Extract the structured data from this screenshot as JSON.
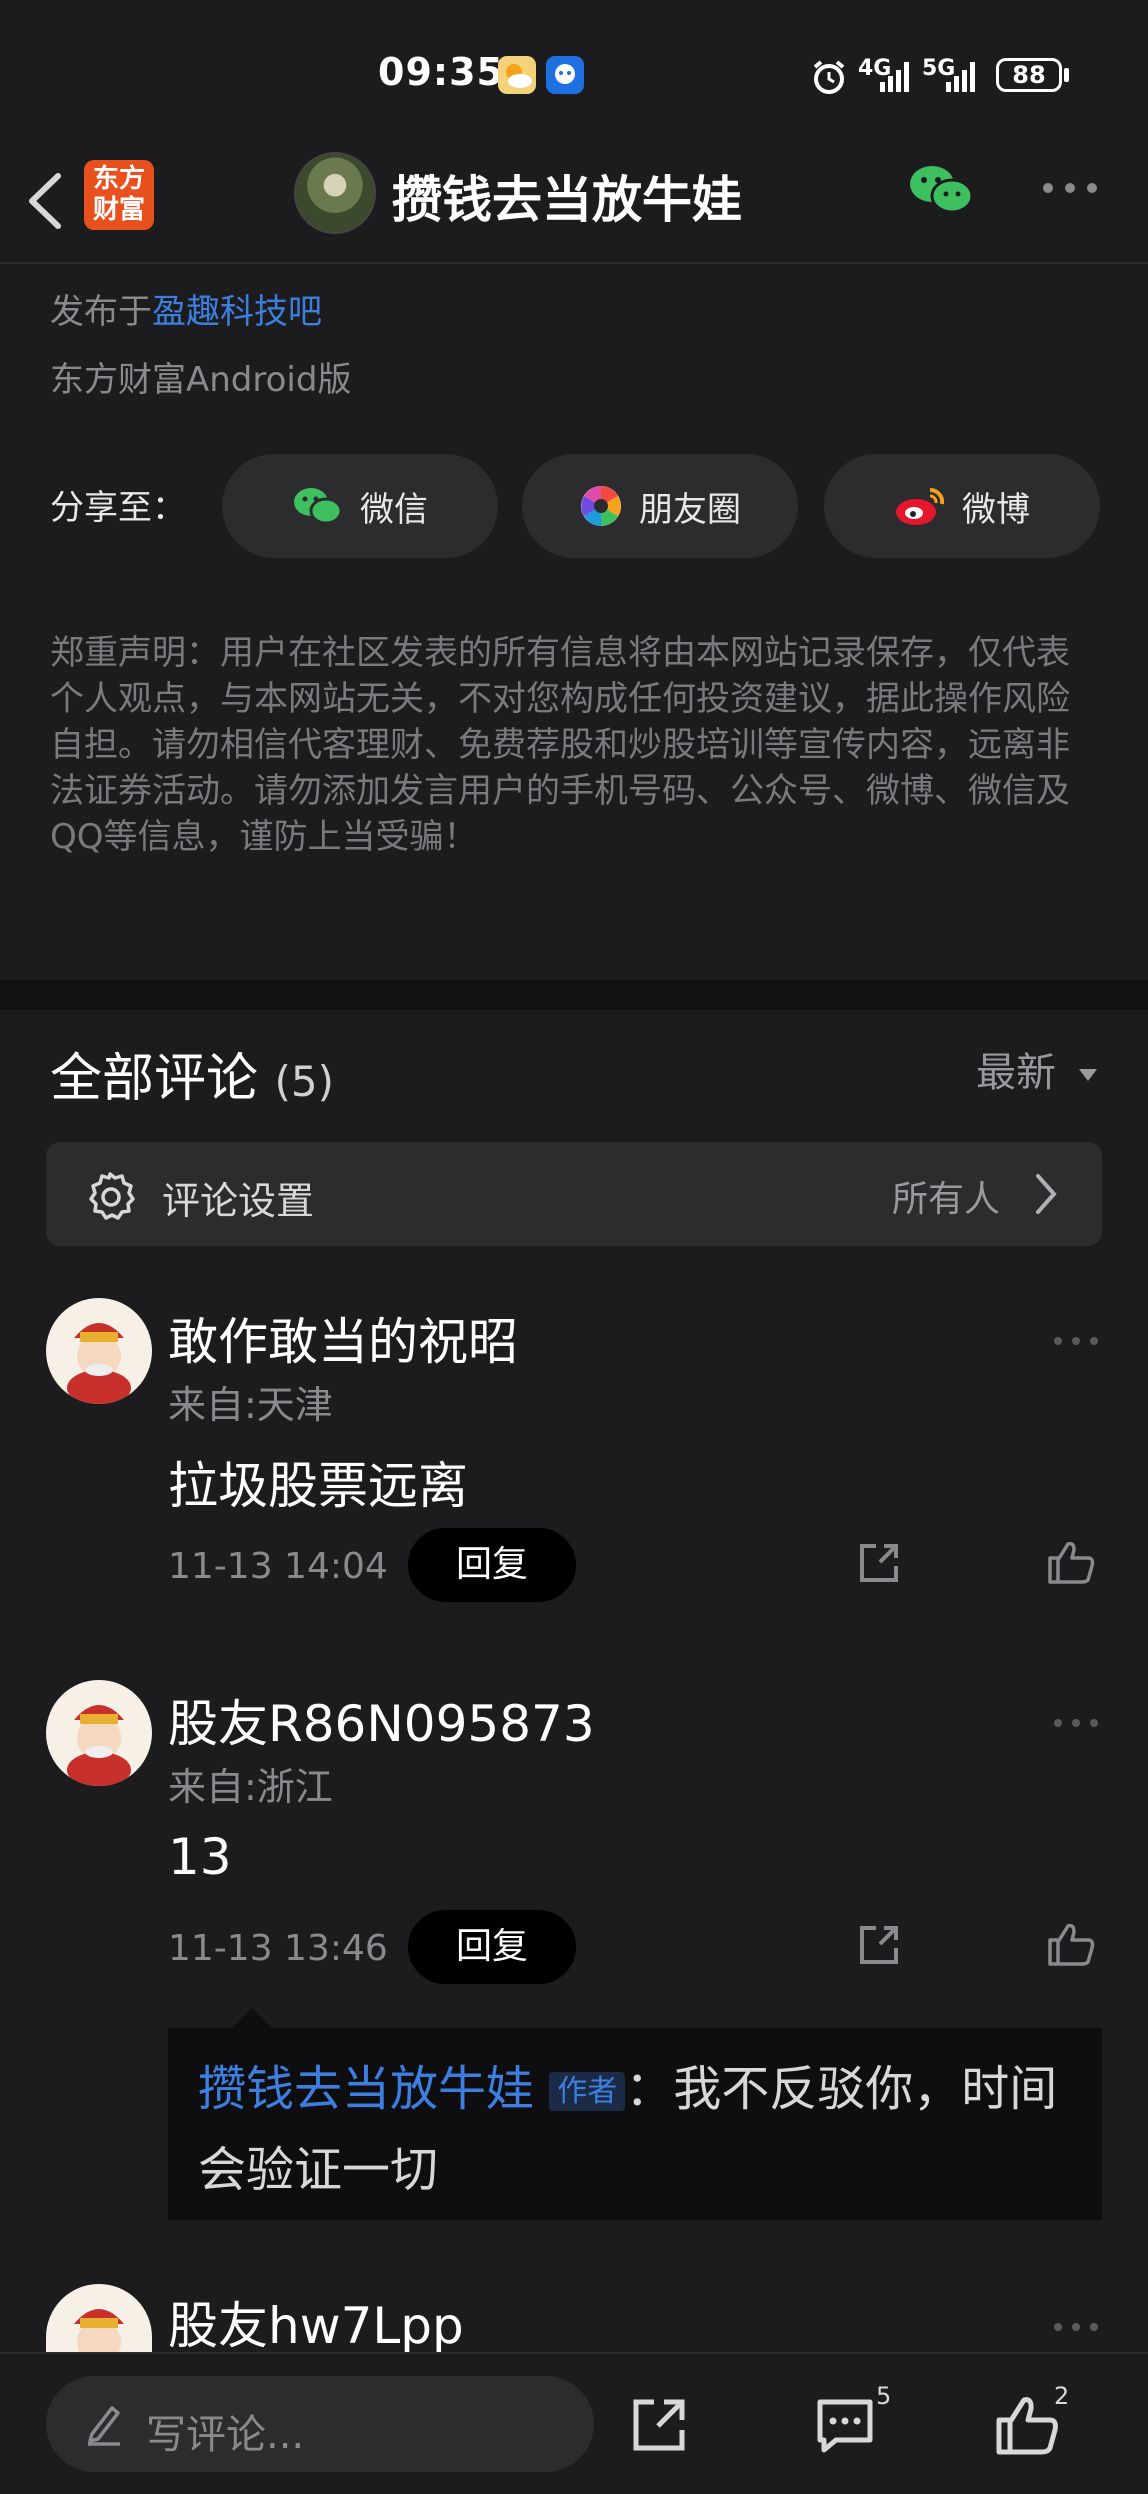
{
  "status_bar": {
    "time": "09:35",
    "net1": "4G",
    "net2": "5G",
    "battery": "88"
  },
  "header": {
    "logo_text": "东方财富",
    "title": "攒钱去当放牛娃"
  },
  "meta": {
    "published_prefix": "发布于",
    "published_link": "盈趣科技吧",
    "client": "东方财富Android版"
  },
  "share": {
    "label": "分享至：",
    "items": [
      {
        "label": "微信",
        "icon": "wechat-icon"
      },
      {
        "label": "朋友圈",
        "icon": "moments-icon"
      },
      {
        "label": "微博",
        "icon": "weibo-icon"
      }
    ]
  },
  "disclaimer": "郑重声明：用户在社区发表的所有信息将由本网站记录保存，仅代表个人观点，与本网站无关，不对您构成任何投资建议，据此操作风险自担。请勿相信代客理财、免费荐股和炒股培训等宣传内容，远离非法证券活动。请勿添加发言用户的手机号码、公众号、微博、微信及QQ等信息，谨防上当受骗！",
  "comments_section": {
    "title": "全部评论",
    "count": "(5)",
    "sort": "最新",
    "settings_label": "评论设置",
    "settings_value": "所有人"
  },
  "comments": [
    {
      "name": "敢作敢当的祝昭",
      "from": "来自:天津",
      "text": "拉圾股票远离",
      "time": "11-13 14:04",
      "reply": "回复"
    },
    {
      "name": "股友R86N095873",
      "from": "来自:浙江",
      "text": "13",
      "time": "11-13 13:46",
      "reply": "回复",
      "sub_reply": {
        "author": "攒钱去当放牛娃",
        "tag": "作者",
        "text": "：我不反驳你，时间会验证一切"
      }
    },
    {
      "name": "股友hw7Lpp"
    }
  ],
  "bottom_bar": {
    "write_placeholder": "写评论...",
    "comment_count": "5",
    "like_count": "2"
  },
  "colors": {
    "background": "#1c1c1e",
    "link": "#3d7fe0",
    "wechat": "#3ec060",
    "brand": "#e8501e"
  }
}
